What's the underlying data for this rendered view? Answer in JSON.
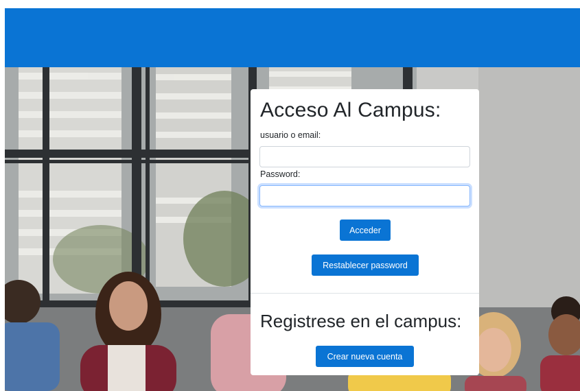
{
  "header": {
    "color": "#0a74d4"
  },
  "login": {
    "title": "Acceso Al Campus:",
    "user_label": "usuario o email:",
    "user_value": "",
    "password_label": "Password:",
    "password_value": "",
    "submit_label": "Acceder",
    "reset_label": "Restablecer password"
  },
  "register": {
    "title": "Registrese en el campus:",
    "button_label": "Crear nueva cuenta"
  },
  "theme": {
    "accent": "#0a74d4",
    "text": "#212529",
    "border": "#ced4da",
    "focus": "#86b7fe"
  }
}
